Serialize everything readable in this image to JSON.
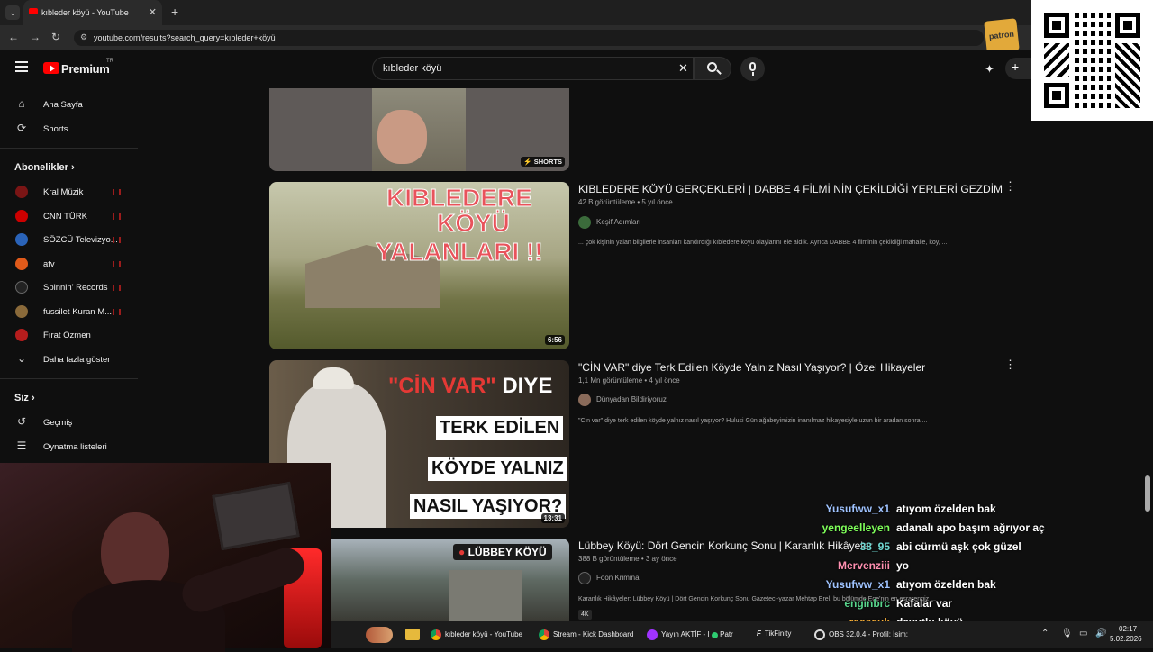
{
  "browser": {
    "tab_title": "kıbleder köyü - YouTube",
    "url": "youtube.com/results?search_query=kıbleder+köyü",
    "new_tab": "+"
  },
  "youtube": {
    "logo": "Premium",
    "logo_sup": "TR",
    "search_value": "kıbleder köyü"
  },
  "sidebar": {
    "main": [
      {
        "label": "Ana Sayfa",
        "icon": "home-icon"
      },
      {
        "label": "Shorts",
        "icon": "shorts-icon"
      }
    ],
    "subs_title": "Abonelikler",
    "subs": [
      {
        "label": "Kral Müzik",
        "color": "#7a1515"
      },
      {
        "label": "CNN TÜRK",
        "color": "#cc0000"
      },
      {
        "label": "SÖZCÜ Televizyo...",
        "color": "#2a63b8"
      },
      {
        "label": "atv",
        "color": "#e05a1a"
      },
      {
        "label": "Spinnin' Records",
        "color": "#222222"
      },
      {
        "label": "fussilet Kuran M...",
        "color": "#8a6a3a"
      },
      {
        "label": "Fırat Özmen",
        "color": "#b51d1d"
      },
      {
        "label": "Daha fazla göster",
        "color": ""
      }
    ],
    "you_title": "Siz",
    "you": [
      {
        "label": "Geçmiş",
        "icon": "history-icon"
      },
      {
        "label": "Oynatma listeleri",
        "icon": "playlist-icon"
      }
    ]
  },
  "results": {
    "shorts_badge": "SHORTS",
    "videos": [
      {
        "title": "KIBLEDERE KÖYÜ GERÇEKLERİ | DABBE 4 FİLMİ NİN ÇEKİLDİĞİ YERLERİ GEZDİM",
        "meta": "42 B görüntüleme • 5 yıl önce",
        "channel": "Keşif Adımları",
        "desc": "... çok kişinin yalan bilgilerle insanları kandırdığı kıbledere köyü olaylarını ele aldık. Ayrıca DABBE 4 filminin çekildiği mahalle, köy, ...",
        "duration": "6:56",
        "thumb_text": [
          "KIBLEDERE",
          "KÖYÜ",
          "YALANLARI !!"
        ]
      },
      {
        "title": "\"CİN VAR\" diye Terk Edilen Köyde Yalnız Nasıl Yaşıyor? | Özel Hikayeler",
        "meta": "1,1 Mn görüntüleme • 4 yıl önce",
        "channel": "Dünyadan Bildiriyoruz",
        "desc": "\"Cin var\" diye terk edilen köyde yalnız nasıl yaşıyor? Hulusi Gün ağabeyimizin inanılmaz hikayesiyle uzun bir aradan sonra ...",
        "duration": "13:31",
        "thumb_text": [
          "\"CİN VAR\"",
          "DIYE",
          "TERK EDİLEN",
          "KÖYDE YALNIZ",
          "NASIL YAŞIYOR?"
        ]
      },
      {
        "title": "Lübbey Köyü: Dört Gencin Korkunç Sonu | Karanlık Hikâyeler",
        "meta": "388 B görüntüleme • 3 ay önce",
        "channel": "Foon Kriminal",
        "desc": "Karanlık Hikâyeler: Lübbey Köyü | Dört Gencin Korkunç Sonu Gazeteci-yazar Mehtap Erel, bu bölümde Ege'nin en esrarengiz ...",
        "badge": "4K",
        "thumb_text": [
          "LÜBBEY KÖYÜ"
        ]
      }
    ]
  },
  "chat": [
    {
      "user": "Yusufww_x1",
      "msg": "atıyom özelden bak",
      "color": "#9fc3ff"
    },
    {
      "user": "yengeelleyen",
      "msg": "adanalı apo başım ağrıyor aç",
      "color": "#7fff5a"
    },
    {
      "user": "38_95",
      "msg": "abi cürmü aşk çok güzel",
      "color": "#6fd6d0"
    },
    {
      "user": "Mervenziii",
      "msg": "yo",
      "color": "#ff8fb0"
    },
    {
      "user": "Yusufww_x1",
      "msg": "atıyom özelden bak",
      "color": "#9fc3ff"
    },
    {
      "user": "enginbrc",
      "msg": "Kafalar var",
      "color": "#58d68d"
    },
    {
      "user": "reeesuk",
      "msg": "davutlu köyü",
      "color": "#ffb43a"
    }
  ],
  "taskbar": {
    "items": [
      "kıbleder köyü - YouTube",
      "Stream - Kick Dashboard",
      "Yayın AKTİF - I",
      "Patr",
      "TikFinity",
      "OBS 32.0.4 - Profil: İsim:"
    ],
    "time": "02:17",
    "date": "5.02.2026"
  },
  "overlay_logo": "patron"
}
